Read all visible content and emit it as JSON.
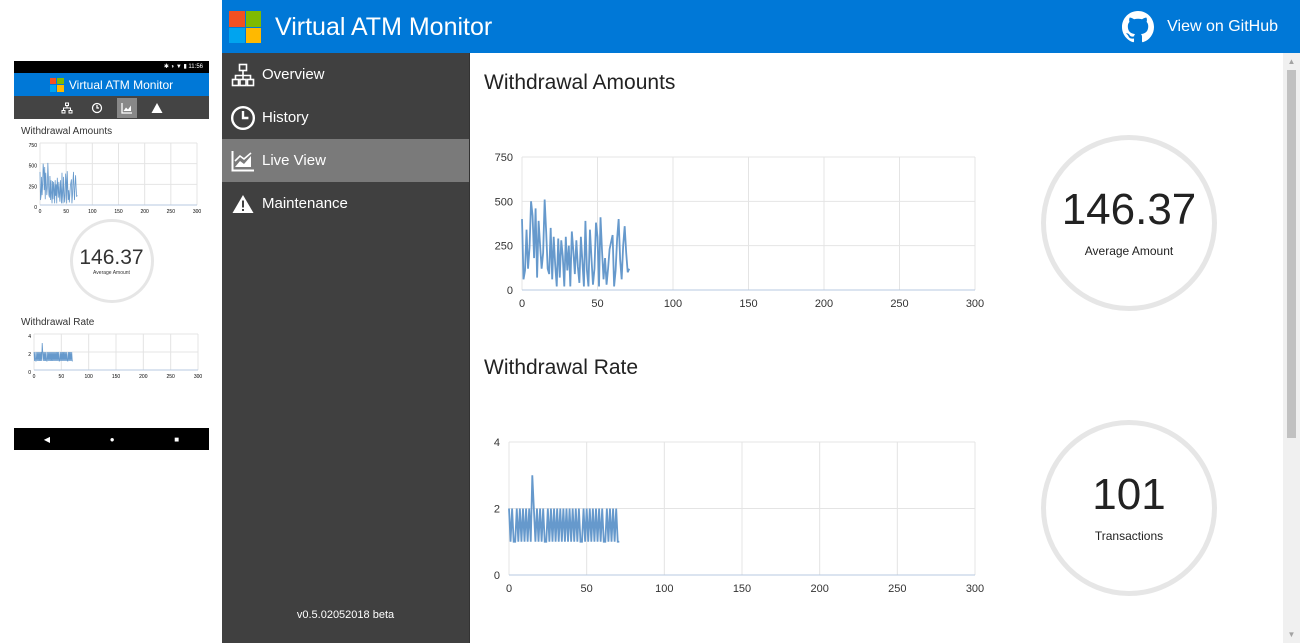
{
  "app": {
    "title": "Virtual ATM Monitor",
    "github_label": "View on GitHub",
    "version": "v0.5.02052018 beta"
  },
  "logo_colors": [
    "#f25022",
    "#7fba00",
    "#00a4ef",
    "#ffb900"
  ],
  "colors": {
    "header": "#0078d7",
    "sidebar": "#404040",
    "active": "#7a7a7a",
    "series": "#6699cc"
  },
  "nav": [
    {
      "label": "Overview",
      "icon": "sitemap-icon"
    },
    {
      "label": "History",
      "icon": "clock-icon"
    },
    {
      "label": "Live View",
      "icon": "area-chart-icon",
      "active": true
    },
    {
      "label": "Maintenance",
      "icon": "warning-icon"
    }
  ],
  "sections": {
    "amounts": {
      "title": "Withdrawal Amounts",
      "stat_value": "146.37",
      "stat_label": "Average Amount"
    },
    "rate": {
      "title": "Withdrawal Rate",
      "stat_value": "101",
      "stat_label": "Transactions"
    }
  },
  "phone": {
    "status": "✱ ◑ ▼ ▮ 11:56",
    "title": "Virtual ATM Monitor",
    "amounts_title": "Withdrawal Amounts",
    "rate_title": "Withdrawal Rate",
    "stat_value": "146.37",
    "stat_label": "Average Amount"
  },
  "chart_data": [
    {
      "type": "line",
      "title": "Withdrawal Amounts",
      "xlim": [
        0,
        300
      ],
      "ylim": [
        0,
        750
      ],
      "x_ticks": [
        0,
        50,
        100,
        150,
        200,
        250,
        300
      ],
      "y_ticks": [
        0,
        250,
        500,
        750
      ],
      "grid": true,
      "series": [
        {
          "values": [
            400,
            60,
            110,
            340,
            120,
            240,
            500,
            420,
            180,
            460,
            70,
            390,
            250,
            120,
            210,
            510,
            330,
            120,
            90,
            350,
            60,
            300,
            140,
            20,
            290,
            70,
            280,
            190,
            20,
            300,
            110,
            250,
            20,
            330,
            220,
            90,
            280,
            130,
            40,
            300,
            160,
            20,
            390,
            110,
            20,
            340,
            180,
            30,
            120,
            380,
            300,
            20,
            410,
            220,
            60,
            180,
            30,
            120,
            230,
            270,
            310,
            20,
            110,
            290,
            400,
            170,
            60,
            250,
            360,
            210,
            100,
            120
          ]
        }
      ]
    },
    {
      "type": "line",
      "title": "Withdrawal Rate",
      "xlim": [
        0,
        300
      ],
      "ylim": [
        0,
        4
      ],
      "x_ticks": [
        0,
        50,
        100,
        150,
        200,
        250,
        300
      ],
      "y_ticks": [
        0,
        2,
        4
      ],
      "grid": true,
      "series": [
        {
          "values": [
            2,
            1,
            2,
            1,
            1,
            2,
            1,
            2,
            1,
            2,
            1,
            2,
            1,
            2,
            1,
            3,
            2,
            1,
            2,
            1,
            2,
            1,
            2,
            1,
            1,
            2,
            1,
            2,
            1,
            2,
            1,
            2,
            1,
            2,
            1,
            2,
            1,
            2,
            1,
            2,
            1,
            2,
            1,
            2,
            1,
            2,
            1,
            1,
            2,
            1,
            2,
            1,
            2,
            1,
            2,
            1,
            2,
            1,
            2,
            1,
            2,
            1,
            1,
            2,
            1,
            2,
            1,
            2,
            1,
            2,
            1,
            1
          ]
        }
      ]
    }
  ]
}
